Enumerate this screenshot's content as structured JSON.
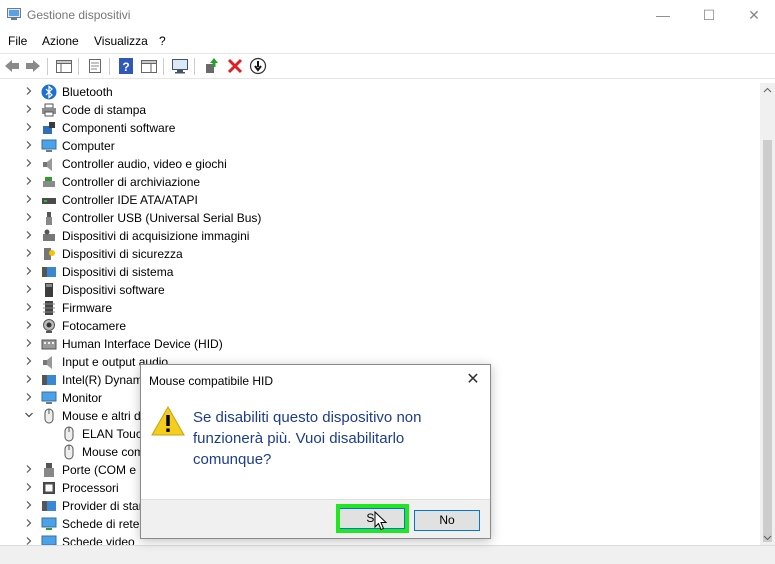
{
  "window": {
    "title": "Gestione dispositivi",
    "minimize_glyph": "—",
    "maximize_glyph": "☐",
    "close_glyph": "✕"
  },
  "menu": [
    "File",
    "Azione",
    "Visualizza",
    "?"
  ],
  "toolbar": {
    "icons": [
      "back-icon",
      "forward-icon",
      "show-hide-tree-icon",
      "properties-icon",
      "help-icon",
      "action-pane-icon",
      "monitor-icon",
      "update-driver-icon",
      "uninstall-icon",
      "disable-device-icon"
    ]
  },
  "tree": {
    "items": [
      {
        "label": "Bluetooth",
        "icon": "bluetooth-icon",
        "expanded": false,
        "level": 0
      },
      {
        "label": "Code di stampa",
        "icon": "printer-icon",
        "expanded": false,
        "level": 0
      },
      {
        "label": "Componenti software",
        "icon": "software-component-icon",
        "expanded": false,
        "level": 0
      },
      {
        "label": "Computer",
        "icon": "computer-icon",
        "expanded": false,
        "level": 0
      },
      {
        "label": "Controller audio, video e giochi",
        "icon": "speaker-icon",
        "expanded": false,
        "level": 0
      },
      {
        "label": "Controller di archiviazione",
        "icon": "storage-controller-icon",
        "expanded": false,
        "level": 0
      },
      {
        "label": "Controller IDE ATA/ATAPI",
        "icon": "ide-controller-icon",
        "expanded": false,
        "level": 0
      },
      {
        "label": "Controller USB (Universal Serial Bus)",
        "icon": "usb-icon",
        "expanded": false,
        "level": 0
      },
      {
        "label": "Dispositivi di acquisizione immagini",
        "icon": "camera-scanner-icon",
        "expanded": false,
        "level": 0
      },
      {
        "label": "Dispositivi di sicurezza",
        "icon": "security-key-icon",
        "expanded": false,
        "level": 0
      },
      {
        "label": "Dispositivi di sistema",
        "icon": "system-device-icon",
        "expanded": false,
        "level": 0
      },
      {
        "label": "Dispositivi software",
        "icon": "software-device-icon",
        "expanded": false,
        "level": 0
      },
      {
        "label": "Firmware",
        "icon": "firmware-icon",
        "expanded": false,
        "level": 0
      },
      {
        "label": "Fotocamere",
        "icon": "webcam-icon",
        "expanded": false,
        "level": 0
      },
      {
        "label": "Human Interface Device (HID)",
        "icon": "keyboard-hid-icon",
        "expanded": false,
        "level": 0
      },
      {
        "label": "Input e output audio",
        "icon": "audio-io-icon",
        "expanded": false,
        "level": 0
      },
      {
        "label": "Intel(R) Dynam",
        "icon": "intel-icon",
        "expanded": false,
        "level": 0
      },
      {
        "label": "Monitor",
        "icon": "monitor-icon",
        "expanded": false,
        "level": 0
      },
      {
        "label": "Mouse e altri d",
        "icon": "mouse-icon",
        "expanded": true,
        "level": 0
      },
      {
        "label": "ELAN Touch",
        "icon": "mouse-icon",
        "expanded": null,
        "level": 1
      },
      {
        "label": "Mouse com",
        "icon": "mouse-icon",
        "expanded": null,
        "level": 1
      },
      {
        "label": "Porte (COM e L",
        "icon": "port-icon",
        "expanded": false,
        "level": 0
      },
      {
        "label": "Processori",
        "icon": "processor-icon",
        "expanded": false,
        "level": 0
      },
      {
        "label": "Provider di stan",
        "icon": "provider-icon",
        "expanded": false,
        "level": 0
      },
      {
        "label": "Schede di rete",
        "icon": "network-adapter-icon",
        "expanded": false,
        "level": 0
      },
      {
        "label": "Schede video",
        "icon": "display-adapter-icon",
        "expanded": false,
        "level": 0
      }
    ]
  },
  "dialog": {
    "title": "Mouse compatibile HID",
    "close_glyph": "✕",
    "icon": "warning-icon",
    "message_line1": "Se disabiliti questo dispositivo non",
    "message_line2": "funzionerà più. Vuoi disabilitarlo",
    "message_line3": "comunque?",
    "yes_label": "Sì",
    "no_label": "No",
    "highlight_color": "#22e622"
  }
}
